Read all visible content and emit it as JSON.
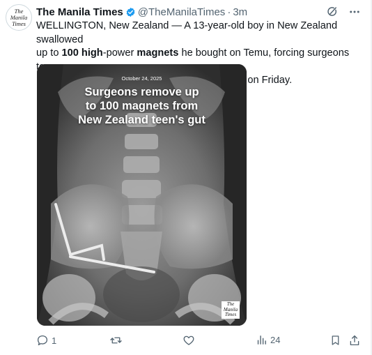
{
  "account": {
    "avatar_lines": [
      "The",
      "Manila",
      "Times"
    ],
    "name": "The Manila Times",
    "handle": "@TheManilaTimes",
    "separator": "·",
    "time": "3m"
  },
  "tweet": {
    "line1": "WELLINGTON, New Zealand — A 13-year-old boy in New Zealand swallowed",
    "line2_a": "up to ",
    "line2_b": "100 high",
    "line2_c": "-power ",
    "line2_d": "magnets",
    "line2_e": " he bought on Temu, forcing surgeons to",
    "line3": "remove tissue from his intestines, doctors said on Friday."
  },
  "media": {
    "date": "October 24, 2025",
    "title_lines": [
      "Surgeons remove up",
      "to 100 magnets from",
      "New Zealand teen's gut"
    ],
    "logo_lines": [
      "The",
      "Manila",
      "Times"
    ]
  },
  "actions": {
    "reply_count": "1",
    "views_count": "24"
  },
  "colors": {
    "verified": "#1d9bf0",
    "secondary_text": "#536471"
  },
  "icons": [
    "verified-badge-icon",
    "grok-icon",
    "more-icon",
    "reply-icon",
    "retweet-icon",
    "like-icon",
    "views-icon",
    "bookmark-icon",
    "share-icon"
  ]
}
